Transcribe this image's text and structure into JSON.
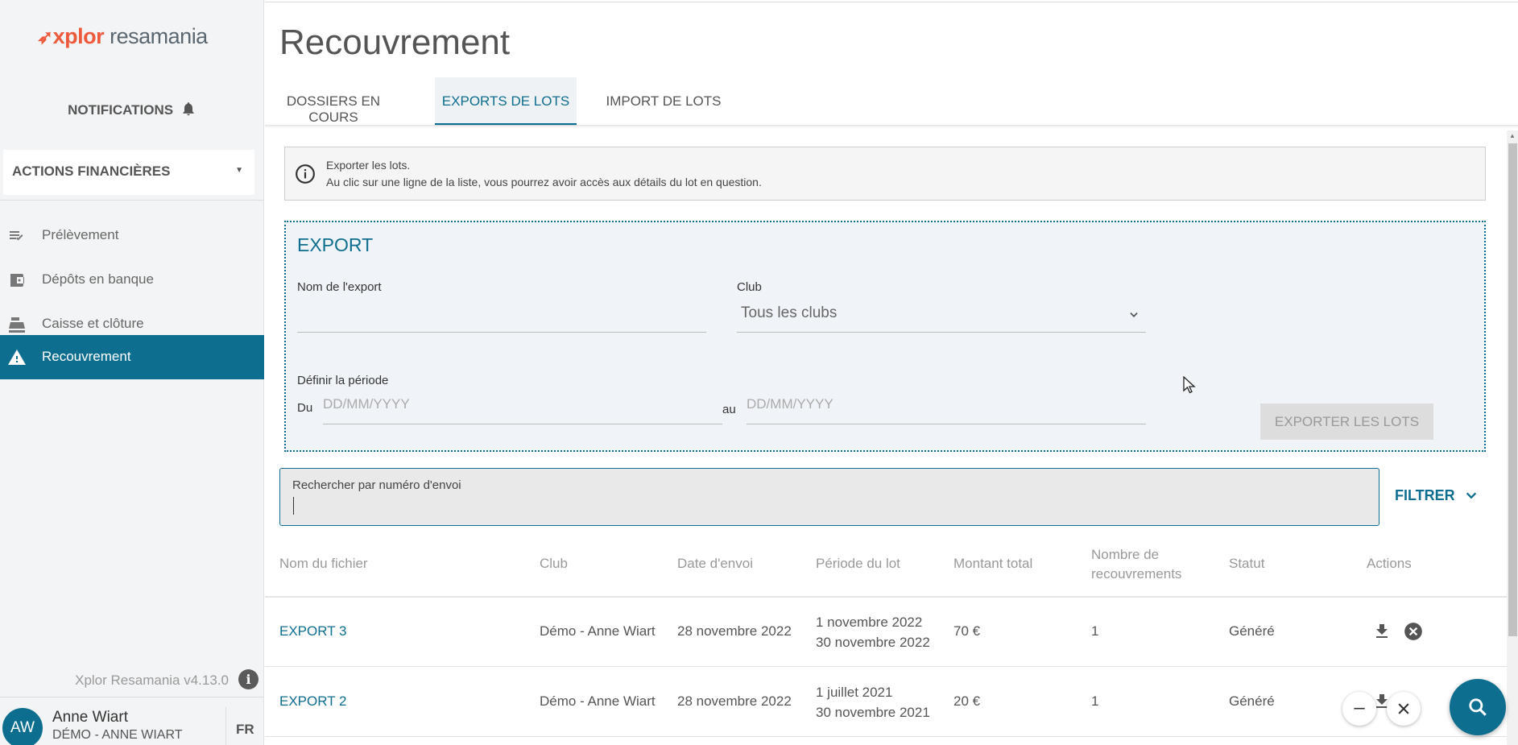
{
  "brand": {
    "logo_x": "xplor",
    "logo_r": "resamania"
  },
  "sidebar": {
    "notifications": "NOTIFICATIONS",
    "section": "ACTIONS FINANCIÈRES",
    "items": [
      {
        "label": "Prélèvement",
        "icon": "checklist-icon"
      },
      {
        "label": "Dépôts en banque",
        "icon": "wallet-icon"
      },
      {
        "label": "Caisse et clôture",
        "icon": "cash-register-icon"
      },
      {
        "label": "Recouvrement",
        "icon": "warning-icon",
        "active": true
      }
    ],
    "version": "Xplor Resamania v4.13.0",
    "user": {
      "initials": "AW",
      "name": "Anne Wiart",
      "club": "DÉMO - ANNE WIART",
      "lang": "FR"
    }
  },
  "page": {
    "title": "Recouvrement",
    "tabs": [
      {
        "label": "DOSSIERS EN COURS",
        "active": false
      },
      {
        "label": "EXPORTS DE LOTS",
        "active": true
      },
      {
        "label": "IMPORT DE LOTS",
        "active": false
      }
    ]
  },
  "info": {
    "line1": "Exporter les lots.",
    "line2": "Au clic sur une ligne de la liste, vous pourrez avoir accès aux détails du lot en question."
  },
  "export": {
    "title": "EXPORT",
    "name_label": "Nom de l'export",
    "name_value": "",
    "club_label": "Club",
    "club_value": "Tous les clubs",
    "period_label": "Définir la période",
    "from_label": "Du",
    "from_placeholder": "DD/MM/YYYY",
    "to_label": "au",
    "to_placeholder": "DD/MM/YYYY",
    "button": "EXPORTER LES LOTS"
  },
  "search": {
    "label": "Rechercher par numéro d'envoi",
    "value": "",
    "filter": "FILTRER"
  },
  "table": {
    "headers": {
      "file": "Nom du fichier",
      "club": "Club",
      "date": "Date d'envoi",
      "period": "Période du lot",
      "amount": "Montant total",
      "count_l1": "Nombre de",
      "count_l2": "recouvrements",
      "status": "Statut",
      "actions": "Actions"
    },
    "rows": [
      {
        "file": "EXPORT 3",
        "club": "Démo - Anne Wiart",
        "date": "28 novembre 2022",
        "period_start": "1 novembre 2022",
        "period_end": "30 novembre 2022",
        "amount": "70 €",
        "count": "1",
        "status": "Généré"
      },
      {
        "file": "EXPORT 2",
        "club": "Démo - Anne Wiart",
        "date": "28 novembre 2022",
        "period_start": "1 juillet 2021",
        "period_end": "30 novembre 2021",
        "amount": "20 €",
        "count": "1",
        "status": "Généré"
      }
    ]
  },
  "colors": {
    "accent": "#0e6e8f",
    "logo": "#ef5a3c"
  }
}
